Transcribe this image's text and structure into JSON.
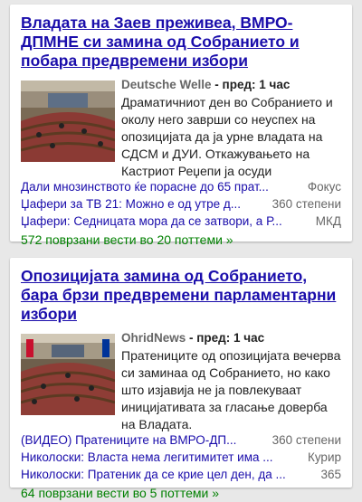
{
  "articles": [
    {
      "title": "Владата на Заев преживеа, ВМРО-ДПМНЕ си замина од Собранието и побара предвремени избори",
      "source": "Deutsche Welle",
      "time": " - пред: 1 час",
      "snippet": "Драматичниот ден во Собранието и околу него заврши со неуспех на опозицијата да ја урне владата на СДСМ и ДУИ. Откажувањето на Кастриот Реџепи ја осуди",
      "related": [
        {
          "text": "Дали мнозинството ќе порасне до 65 прат...",
          "source": "Фокус"
        },
        {
          "text": "Џафери за ТВ 21: Можно е од утре д...",
          "source": "360 степени"
        },
        {
          "text": "Џафери: Седницата мора да се затвори, а Р...",
          "source": "МКД"
        }
      ],
      "more": "572 поврзани вести во 20 поттеми »"
    },
    {
      "title": "Опозицијата замина од Собранието, бара брзи предвремени парламентарни избори",
      "source": "OhridNews",
      "time": " - пред: 1 час",
      "snippet": "Пратениците од опозицијата вечерва си заминаа од Собранието, но како што изјавија не ја повлекуваат иницијативата за гласање доверба на Владата.",
      "related": [
        {
          "text": "(ВИДЕО) Пратениците на ВМРО-ДП...",
          "source": "360 степени"
        },
        {
          "text": "Николоски: Власта нема легитимитет има ...",
          "source": "Курир"
        },
        {
          "text": "Николоски: Пратеник да се крие цел ден, да ...",
          "source": "365"
        }
      ],
      "more": "64 поврзани вести во 5 поттеми »"
    }
  ]
}
